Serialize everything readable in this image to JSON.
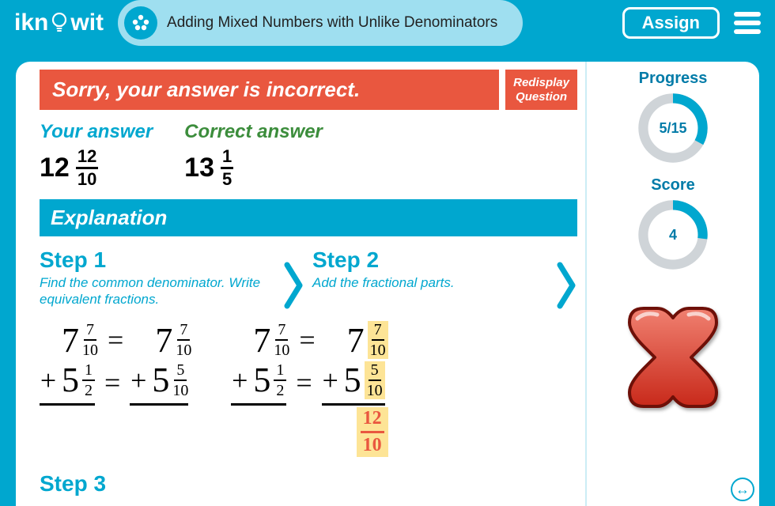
{
  "header": {
    "logo_text_left": "ikn",
    "logo_text_right": "wit",
    "title": "Adding Mixed Numbers with Unlike Denominators",
    "assign_label": "Assign"
  },
  "feedback": {
    "message": "Sorry, your answer is incorrect.",
    "redisplay_line1": "Redisplay",
    "redisplay_line2": "Question"
  },
  "answers": {
    "your_label": "Your answer",
    "your_whole": "12",
    "your_num": "12",
    "your_den": "10",
    "correct_label": "Correct answer",
    "correct_whole": "13",
    "correct_num": "1",
    "correct_den": "5"
  },
  "explanation_label": "Explanation",
  "steps": {
    "s1_title": "Step 1",
    "s1_sub": "Find the common denominator. Write equivalent fractions.",
    "s2_title": "Step 2",
    "s2_sub": "Add the fractional parts.",
    "s3_title": "Step 3"
  },
  "math": {
    "a_whole": "7",
    "a_num": "7",
    "a_den": "10",
    "b_whole": "5",
    "b_num": "1",
    "b_den": "2",
    "a2_num": "7",
    "a2_den": "10",
    "b2_num": "5",
    "b2_den": "10",
    "sum_num": "12",
    "sum_den": "10",
    "plus": "+",
    "eq": "="
  },
  "side": {
    "progress_label": "Progress",
    "progress_text": "5/15",
    "progress_pct": 33,
    "score_label": "Score",
    "score_text": "4",
    "score_pct": 27
  },
  "icons": {
    "swap": "↔"
  }
}
